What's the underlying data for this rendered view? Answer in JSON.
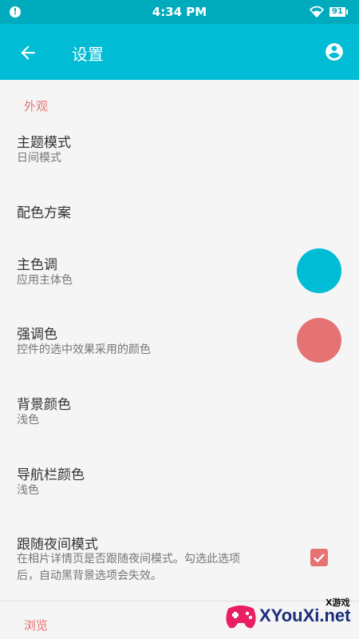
{
  "status_bar": {
    "alert_icon": "alert-circle-icon",
    "time": "4:34 PM",
    "wifi_icon": "wifi-icon",
    "battery": "91"
  },
  "app_bar": {
    "title": "设置",
    "back_icon": "arrow-back-icon",
    "account_icon": "account-circle-icon",
    "background_color": "#00bcd4"
  },
  "sections": {
    "appearance": "外观",
    "browse": "浏览"
  },
  "prefs": {
    "theme_mode": {
      "title": "主题模式",
      "summary": "日间模式"
    },
    "color_scheme": {
      "title": "配色方案"
    },
    "primary_color": {
      "title": "主色调",
      "summary": "应用主体色",
      "color": "#00bcd4"
    },
    "accent_color": {
      "title": "强调色",
      "summary": "控件的选中效果采用的颜色",
      "color": "#e57373"
    },
    "background_color": {
      "title": "背景颜色",
      "summary": "浅色"
    },
    "nav_bar_color": {
      "title": "导航栏颜色",
      "summary": "浅色"
    },
    "follow_night": {
      "title": "跟随夜间模式",
      "summary_line1": "在相片详情页是否跟随夜间模式。勾选此选项",
      "summary_line2": "后，自动黑背景选项会失效。",
      "checked": true
    }
  },
  "watermark": {
    "small": "X游戏",
    "text": "XYouXi.net"
  }
}
